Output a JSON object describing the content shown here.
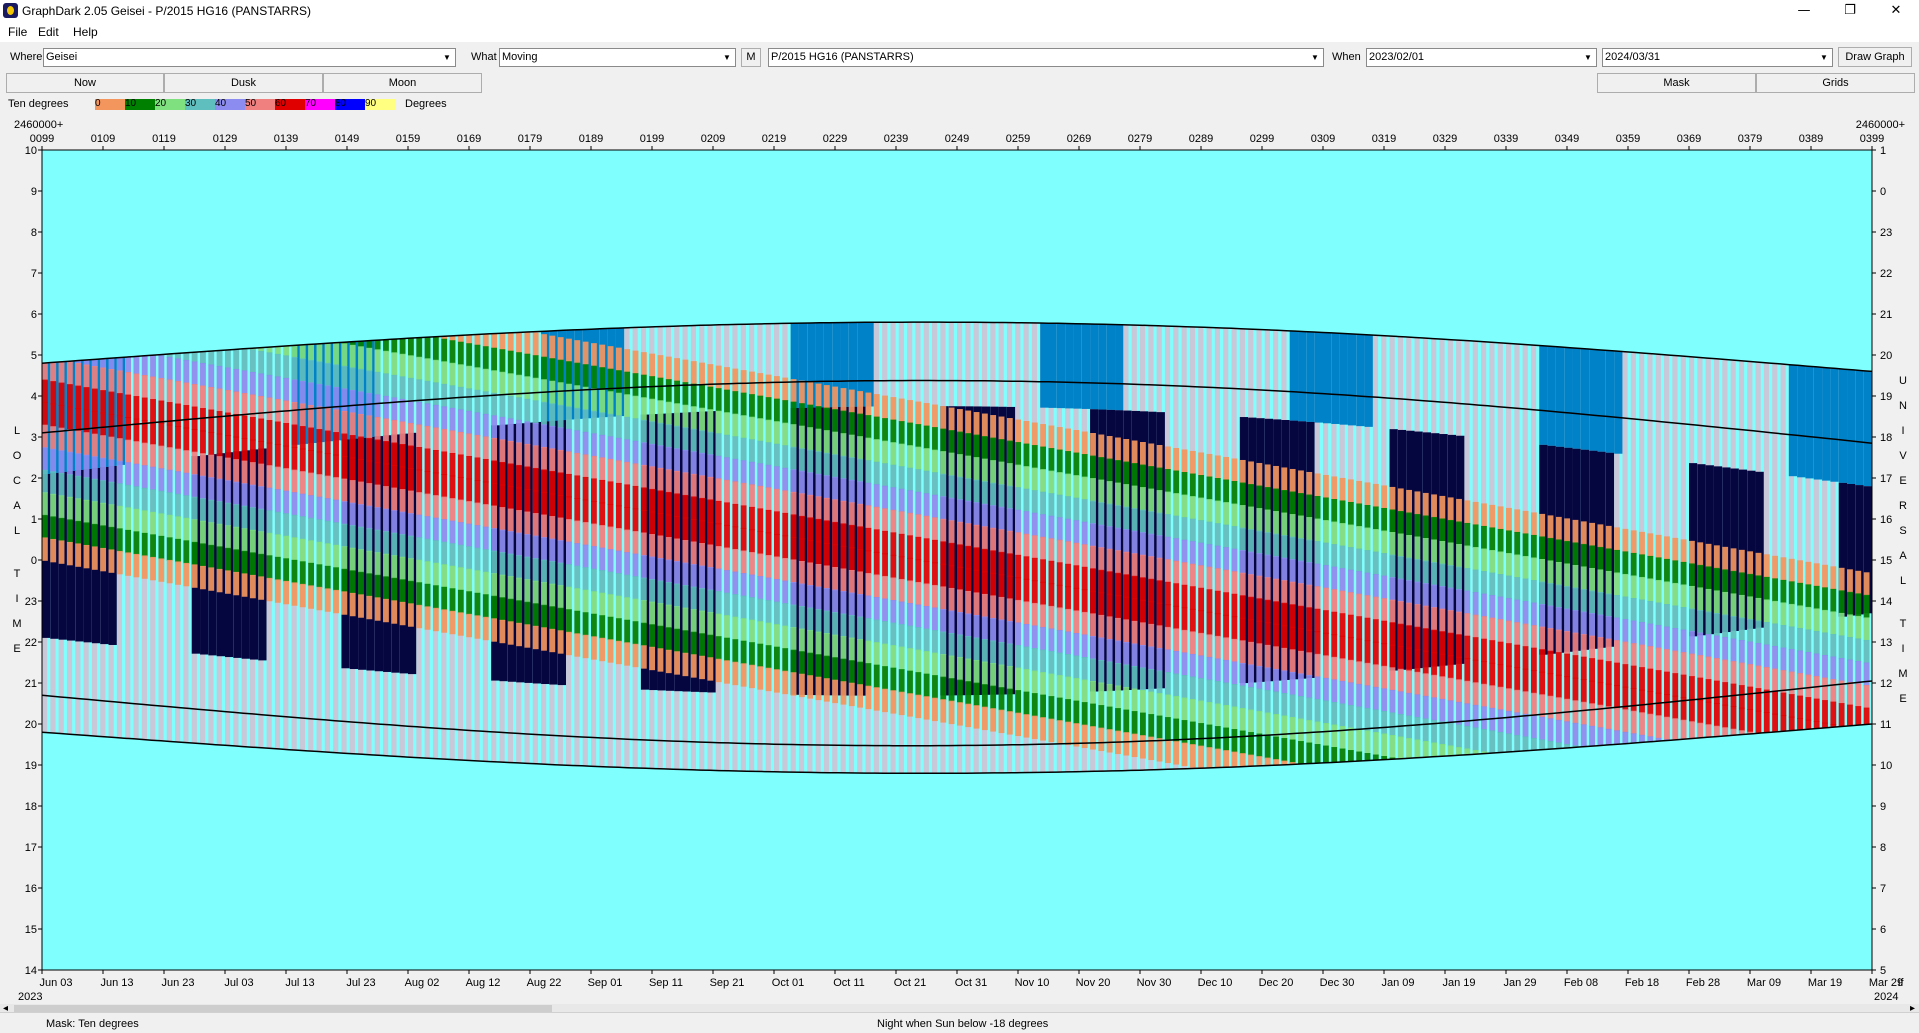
{
  "window": {
    "title": "GraphDark 2.05  Geisei  -  P/2015 HG16 (PANSTARRS)",
    "minimize": "—",
    "maximize": "❐",
    "close": "✕"
  },
  "menu": [
    "File",
    "Edit",
    "Help"
  ],
  "toolbar": {
    "where_label": "Where",
    "where_value": "Geisei",
    "what_label": "What",
    "what_value": "Moving",
    "m_button": "M",
    "object_value": "P/2015 HG16 (PANSTARRS)",
    "when_label": "When",
    "start_date": "2023/02/01",
    "end_date": "2024/03/31",
    "draw_button": "Draw Graph"
  },
  "row2": {
    "now": "Now",
    "dusk": "Dusk",
    "moon": "Moon",
    "mask": "Mask",
    "grids": "Grids"
  },
  "legend": {
    "title": "Ten degrees",
    "labels": [
      "0",
      "10",
      "20",
      "30",
      "40",
      "50",
      "60",
      "70",
      "80",
      "90"
    ],
    "colors": [
      "#f3965e",
      "#008000",
      "#7fe07f",
      "#5fbfbf",
      "#8c8cf0",
      "#f08080",
      "#e00000",
      "#ff00ff",
      "#0000ff",
      "#ffff80"
    ],
    "suffix": "Degrees"
  },
  "chart": {
    "jd_prefix": "2460000+",
    "jd_ticks": [
      "0099",
      "0109",
      "0119",
      "0129",
      "0139",
      "0149",
      "0159",
      "0169",
      "0179",
      "0189",
      "0199",
      "0209",
      "0219",
      "0229",
      "0239",
      "0249",
      "0259",
      "0269",
      "0279",
      "0289",
      "0299",
      "0309",
      "0319",
      "0329",
      "0339",
      "0349",
      "0359",
      "0369",
      "0379",
      "0389",
      "0399"
    ],
    "date_ticks": [
      "Jun 03",
      "Jun 13",
      "Jun 23",
      "Jul 03",
      "Jul 13",
      "Jul 23",
      "Aug 02",
      "Aug 12",
      "Aug 22",
      "Sep 01",
      "Sep 11",
      "Sep 21",
      "Oct 01",
      "Oct 11",
      "Oct 21",
      "Oct 31",
      "Nov 10",
      "Nov 20",
      "Nov 30",
      "Dec 10",
      "Dec 20",
      "Dec 30",
      "Jan 09",
      "Jan 19",
      "Jan 29",
      "Feb 08",
      "Feb 18",
      "Feb 28",
      "Mar 09",
      "Mar 19",
      "Mar 29"
    ],
    "year_left": "2023",
    "year_right": "2024",
    "right_corner": "if",
    "local_ticks": [
      "10",
      "9",
      "8",
      "7",
      "6",
      "5",
      "4",
      "3",
      "2",
      "1",
      "0",
      "23",
      "22",
      "21",
      "20",
      "19",
      "18",
      "17",
      "16",
      "15",
      "14"
    ],
    "ut_ticks": [
      "1",
      "0",
      "23",
      "22",
      "21",
      "20",
      "19",
      "18",
      "17",
      "16",
      "15",
      "14",
      "13",
      "12",
      "11",
      "10",
      "9",
      "8",
      "7",
      "6",
      "5"
    ],
    "left_axis_label": "LOCAL TIME",
    "right_axis_label": "UNIVERSAL TIME",
    "colors": {
      "day": "#80ffff",
      "night": "#050540",
      "moon": "#0082c8",
      "twilight_stripe": "#c8c8d8",
      "curve": "#000000"
    }
  },
  "status": {
    "mask": "Mask:  Ten degrees",
    "night": "Night when Sun below -18 degrees"
  }
}
